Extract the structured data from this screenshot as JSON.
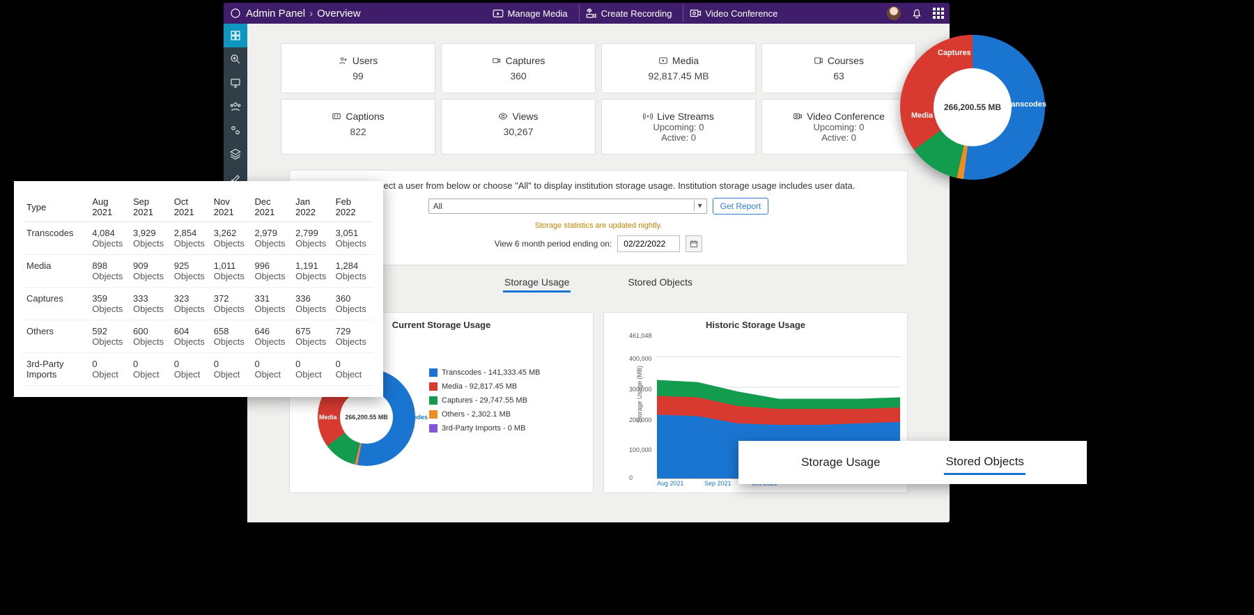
{
  "breadcrumb": {
    "root": "Admin Panel",
    "sep": "›",
    "page": "Overview"
  },
  "topbar": {
    "manage_media": "Manage Media",
    "create_recording": "Create Recording",
    "video_conference": "Video Conference"
  },
  "cards": {
    "users": {
      "label": "Users",
      "value": "99"
    },
    "captures": {
      "label": "Captures",
      "value": "360"
    },
    "media": {
      "label": "Media",
      "value": "92,817.45 MB"
    },
    "courses": {
      "label": "Courses",
      "value": "63"
    },
    "captions": {
      "label": "Captions",
      "value": "822"
    },
    "views": {
      "label": "Views",
      "value": "30,267"
    },
    "live": {
      "label": "Live Streams",
      "upcoming_lbl": "Upcoming:",
      "upcoming": "0",
      "active_lbl": "Active:",
      "active": "0"
    },
    "vc": {
      "label": "Video Conference",
      "upcoming_lbl": "Upcoming:",
      "upcoming": "0",
      "active_lbl": "Active:",
      "active": "0"
    }
  },
  "strip": {
    "text": "Please select a user from below or choose \"All\" to display institution storage usage. Institution storage usage includes user data.",
    "select_value": "All",
    "get_report": "Get Report",
    "note": "Storage statistics are updated nightly.",
    "period_label": "View 6 month period ending on:",
    "date": "02/22/2022"
  },
  "tabs": {
    "usage": "Storage Usage",
    "objects": "Stored Objects"
  },
  "overlay_tabs": {
    "usage": "Storage Usage",
    "objects": "Stored Objects"
  },
  "donut_big": {
    "center": "266,200.55 MB",
    "labels": {
      "captures": "Captures",
      "transcodes": "Transcodes",
      "media": "Media"
    }
  },
  "current_storage": {
    "title": "Current Storage Usage",
    "center": "266,200.55 MB",
    "donut_labels": {
      "media": "Media",
      "transcodes": "Transcodes"
    },
    "legend": {
      "transcodes": "Transcodes - 141,333.45 MB",
      "media": "Media - 92,817.45 MB",
      "captures": "Captures - 29,747.55 MB",
      "others": "Others - 2,302.1 MB",
      "third": "3rd-Party Imports - 0 MB"
    }
  },
  "historic": {
    "title": "Historic Storage Usage",
    "ylabel": "Storage Usage (MB)",
    "yticks": [
      "461,048",
      "400,000",
      "300,000",
      "200,000",
      "100,000",
      "0"
    ],
    "xticks": [
      "Aug 2021",
      "Sep 2021",
      "Oct 2021"
    ]
  },
  "table": {
    "header": [
      "Type",
      "Aug 2021",
      "Sep 2021",
      "Oct 2021",
      "Nov 2021",
      "Dec 2021",
      "Jan 2022",
      "Feb 2022"
    ],
    "obj_unit": "Objects",
    "obj_unit_sing": "Object",
    "rows": [
      {
        "type": "Transcodes",
        "vals": [
          "4,084",
          "3,929",
          "2,854",
          "3,262",
          "2,979",
          "2,799",
          "3,051"
        ]
      },
      {
        "type": "Media",
        "vals": [
          "898",
          "909",
          "925",
          "1,011",
          "996",
          "1,191",
          "1,284"
        ]
      },
      {
        "type": "Captures",
        "vals": [
          "359",
          "333",
          "323",
          "372",
          "331",
          "336",
          "360"
        ]
      },
      {
        "type": "Others",
        "vals": [
          "592",
          "600",
          "604",
          "658",
          "646",
          "675",
          "729"
        ]
      },
      {
        "type": "3rd-Party Imports",
        "vals": [
          "0",
          "0",
          "0",
          "0",
          "0",
          "0",
          "0"
        ],
        "singular": true
      }
    ]
  },
  "chart_data": [
    {
      "type": "pie",
      "title": "Current Storage Usage",
      "center_total": "266,200.55 MB",
      "series": [
        {
          "name": "Transcodes",
          "value": 141333.45,
          "unit": "MB",
          "color": "#1a75d1"
        },
        {
          "name": "Media",
          "value": 92817.45,
          "unit": "MB",
          "color": "#d83a30"
        },
        {
          "name": "Captures",
          "value": 29747.55,
          "unit": "MB",
          "color": "#139c4e"
        },
        {
          "name": "Others",
          "value": 2302.1,
          "unit": "MB",
          "color": "#ef8c22"
        },
        {
          "name": "3rd-Party Imports",
          "value": 0,
          "unit": "MB",
          "color": "#8455d8"
        }
      ]
    },
    {
      "type": "area",
      "title": "Historic Storage Usage",
      "xlabel": "",
      "ylabel": "Storage Usage (MB)",
      "ylim": [
        0,
        461048
      ],
      "categories": [
        "Aug 2021",
        "Sep 2021",
        "Oct 2021",
        "Nov 2021",
        "Dec 2021",
        "Jan 2022",
        "Feb 2022"
      ],
      "series": [
        {
          "name": "Transcodes",
          "color": "#1a75d1",
          "values": [
            200000,
            195000,
            170000,
            175000,
            175000,
            175000,
            180000
          ]
        },
        {
          "name": "Media",
          "color": "#d83a30",
          "values": [
            60000,
            60000,
            45000,
            45000,
            45000,
            45000,
            45000
          ]
        },
        {
          "name": "Captures",
          "color": "#139c4e",
          "values": [
            55000,
            50000,
            50000,
            35000,
            35000,
            35000,
            35000
          ]
        }
      ],
      "note": "stacked area; values approximate from gridlines"
    },
    {
      "type": "table",
      "title": "Stored Objects",
      "columns": [
        "Type",
        "Aug 2021",
        "Sep 2021",
        "Oct 2021",
        "Nov 2021",
        "Dec 2021",
        "Jan 2022",
        "Feb 2022"
      ],
      "rows": [
        [
          "Transcodes",
          4084,
          3929,
          2854,
          3262,
          2979,
          2799,
          3051
        ],
        [
          "Media",
          898,
          909,
          925,
          1011,
          996,
          1191,
          1284
        ],
        [
          "Captures",
          359,
          333,
          323,
          372,
          331,
          336,
          360
        ],
        [
          "Others",
          592,
          600,
          604,
          658,
          646,
          675,
          729
        ],
        [
          "3rd-Party Imports",
          0,
          0,
          0,
          0,
          0,
          0,
          0
        ]
      ],
      "unit": "Objects"
    }
  ]
}
